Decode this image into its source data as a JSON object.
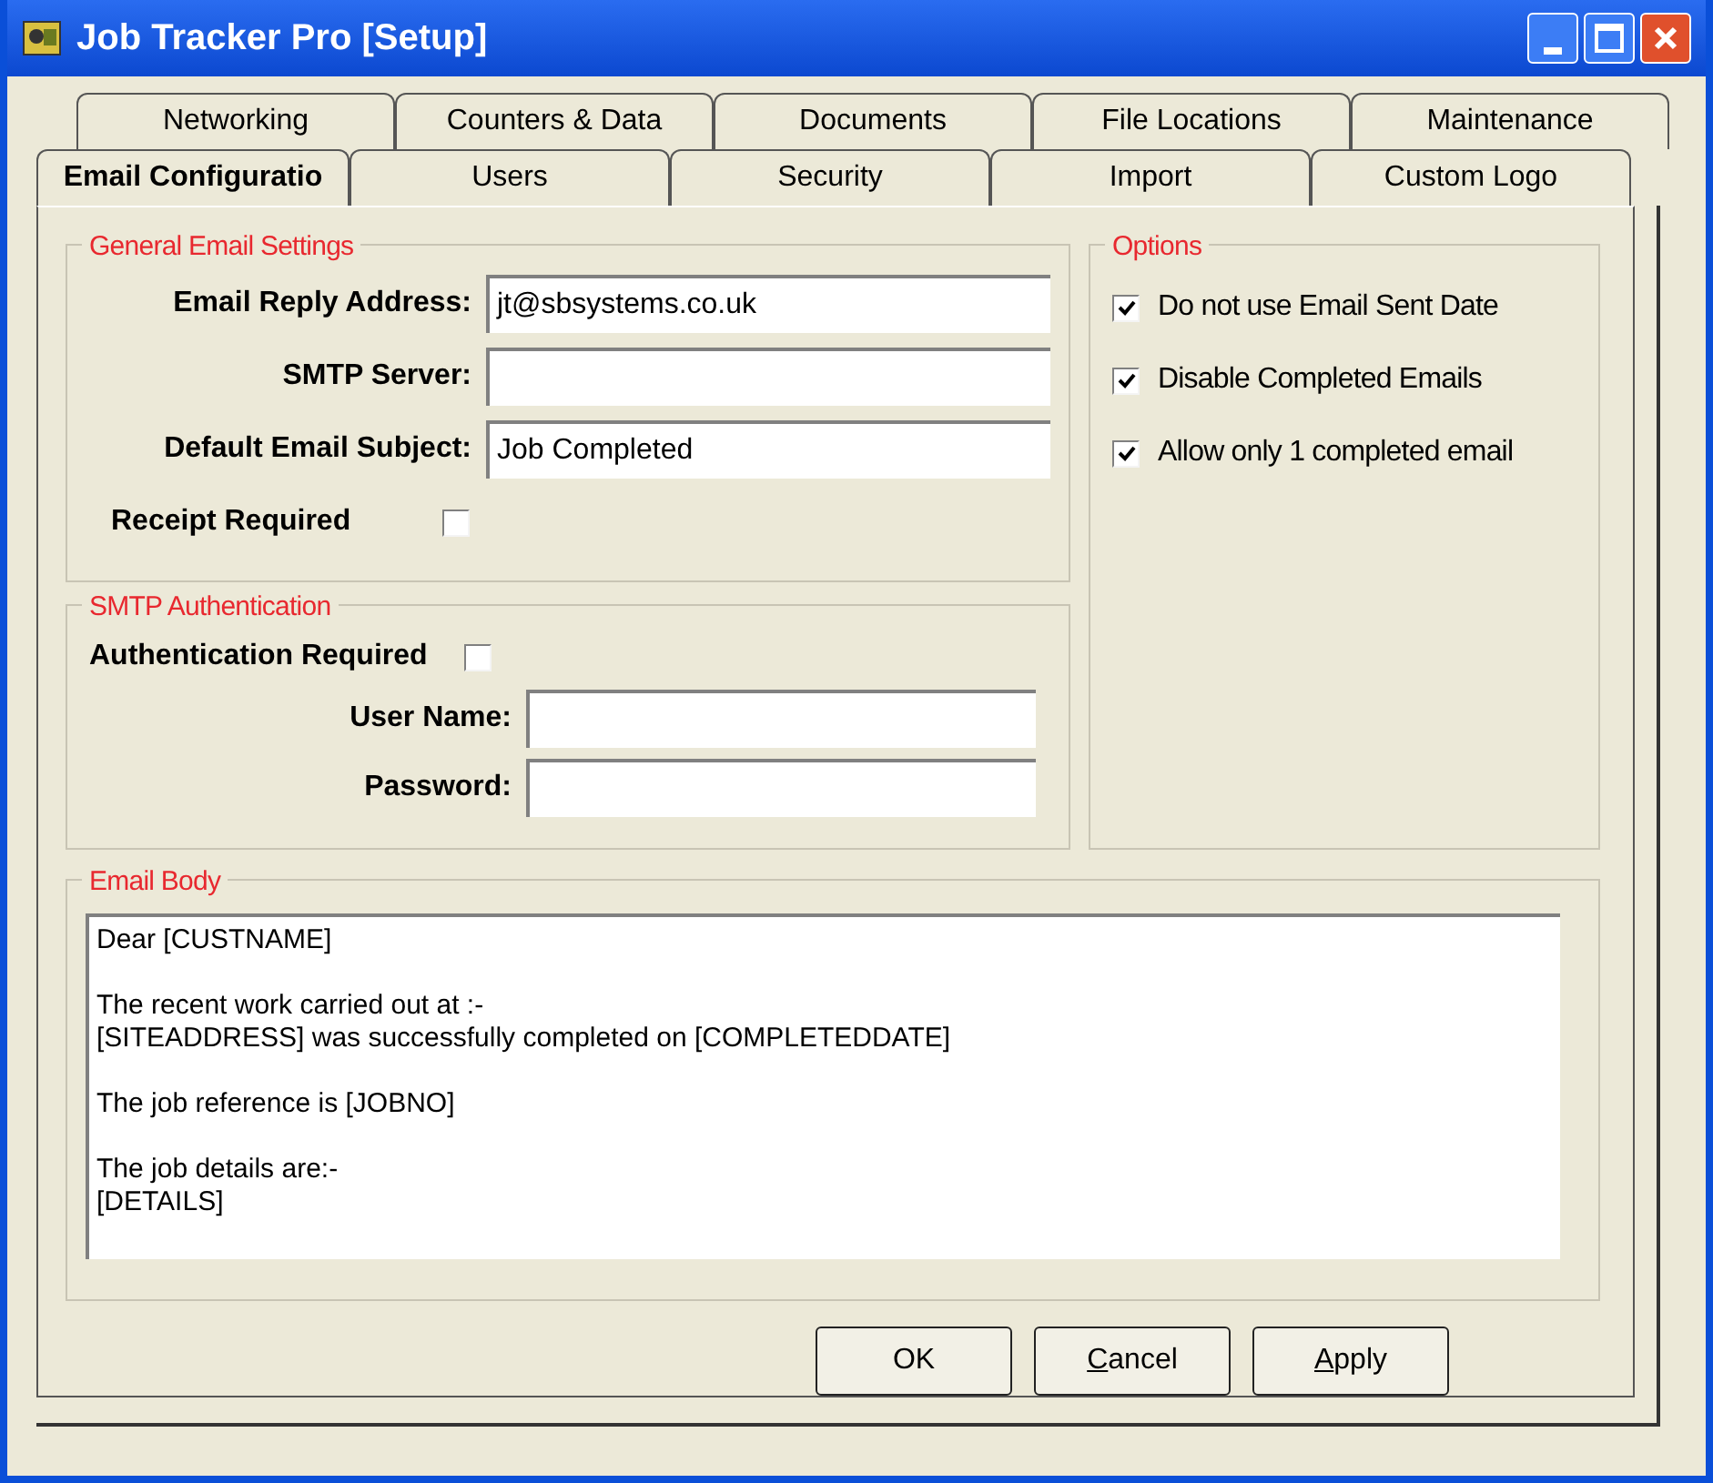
{
  "window": {
    "title": "Job Tracker Pro [Setup]"
  },
  "tab_rows": [
    [
      {
        "label": "Networking",
        "selected": false
      },
      {
        "label": "Counters & Data",
        "selected": false
      },
      {
        "label": "Documents",
        "selected": false
      },
      {
        "label": "File Locations",
        "selected": false
      },
      {
        "label": "Maintenance",
        "selected": false
      }
    ],
    [
      {
        "label": "Email Configuratio",
        "selected": true
      },
      {
        "label": "Users",
        "selected": false
      },
      {
        "label": "Security",
        "selected": false
      },
      {
        "label": "Import",
        "selected": false
      },
      {
        "label": "Custom Logo",
        "selected": false
      }
    ]
  ],
  "general": {
    "title": "General Email Settings",
    "fields": [
      {
        "label": "Email Reply Address:",
        "value": "jt@sbsystems.co.uk"
      },
      {
        "label": "SMTP Server:"
      },
      {
        "label": "Default Email Subject:",
        "value": "Job Completed"
      }
    ],
    "receipt": {
      "label": "Receipt Required",
      "checked": false
    }
  },
  "auth": {
    "title": "SMTP Authentication",
    "required": {
      "label": "Authentication Required",
      "checked": false
    },
    "fields": [
      {
        "label": "User Name:"
      },
      {
        "label": "Password:"
      }
    ]
  },
  "options": {
    "title": "Options",
    "items": [
      {
        "label": "Do not use Email Sent Date",
        "checked": true
      },
      {
        "label": "Disable Completed Emails",
        "checked": true
      },
      {
        "label": "Allow only 1 completed email",
        "checked": true
      }
    ]
  },
  "email_body": {
    "title": "Email Body",
    "paragraphs": [
      [
        "Dear [CUSTNAME]"
      ],
      [
        "The recent work carried out at :-",
        "[SITEADDRESS] was successfully completed on [COMPLETEDDATE]"
      ],
      [
        "The job reference is [JOBNO]"
      ],
      [
        "The job details are:-",
        "[DETAILS]"
      ]
    ]
  },
  "buttons": [
    {
      "label": "OK",
      "mnemonic": false
    },
    {
      "label": "Cancel",
      "mnemonic": true
    },
    {
      "label": "Apply",
      "mnemonic": true
    }
  ]
}
